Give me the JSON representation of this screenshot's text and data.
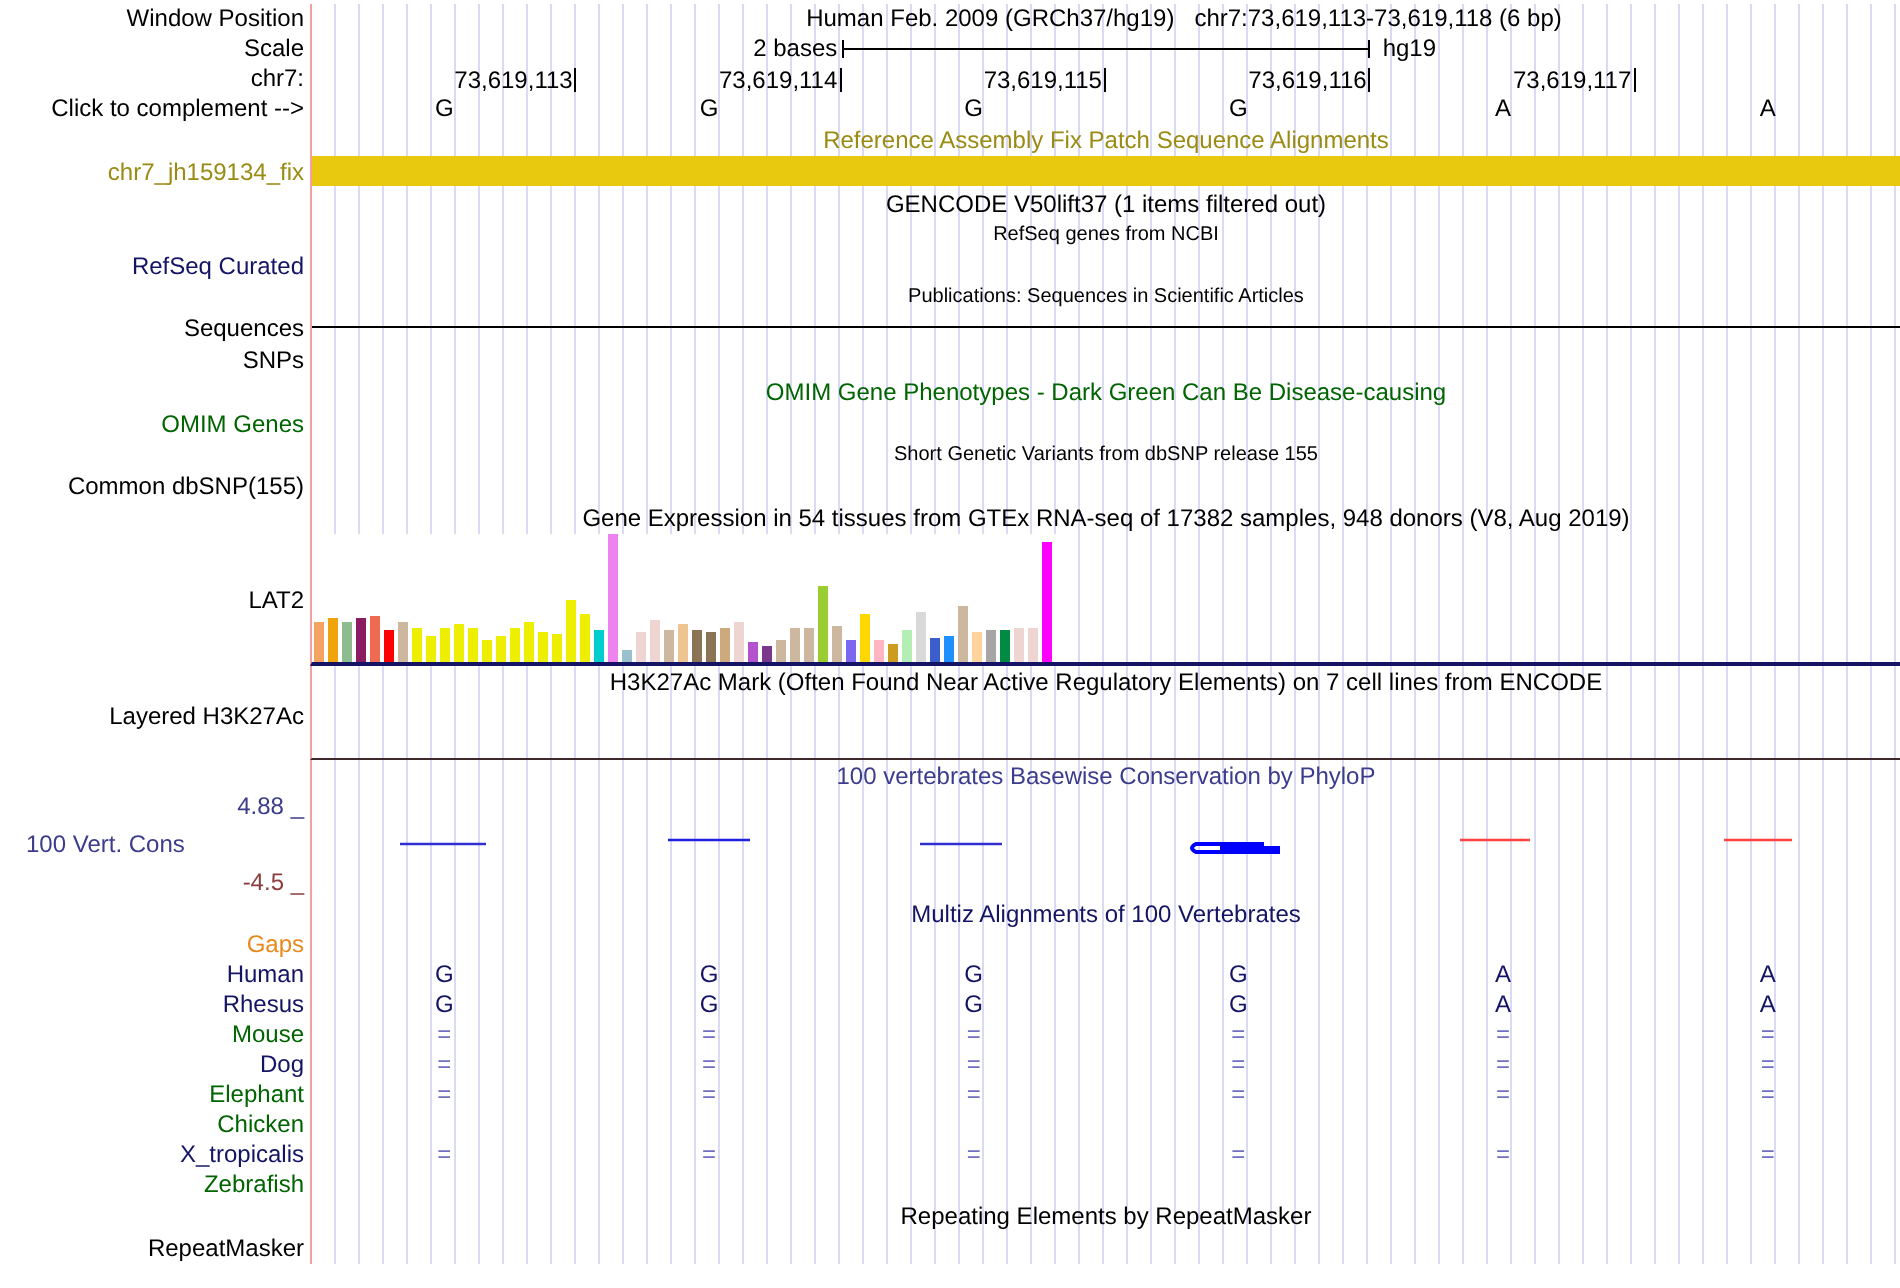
{
  "position": {
    "label": "Window Position",
    "assembly": "Human Feb. 2009 (GRCh37/hg19)",
    "range": "chr7:73,619,113-73,619,118 (6 bp)"
  },
  "scale": {
    "label": "Scale",
    "length": "2 bases",
    "assembly": "hg19"
  },
  "ruler": {
    "label": "chr7:",
    "ticks": [
      "73,619,113",
      "73,619,114",
      "73,619,115",
      "73,619,116",
      "73,619,117"
    ]
  },
  "complement": {
    "label": "Click to complement -->",
    "bases": [
      "G",
      "G",
      "G",
      "G",
      "A",
      "A"
    ]
  },
  "rows": [
    {
      "kind": "title",
      "text": "Reference Assembly Fix Patch Sequence Alignments",
      "color": "#9a8b13"
    },
    {
      "kind": "bar",
      "label": "chr7_jh159134_fix",
      "color": "#9a8b13"
    },
    {
      "kind": "title",
      "text": "GENCODE V50lift37 (1 items filtered out)",
      "color": "#000000"
    },
    {
      "kind": "subtitle",
      "text": "RefSeq genes from NCBI"
    },
    {
      "kind": "label",
      "label": "RefSeq Curated",
      "color": "#141464"
    },
    {
      "kind": "subtitle",
      "text": "Publications: Sequences in Scientific Articles"
    },
    {
      "kind": "line",
      "label": "Sequences",
      "color": "#000000"
    },
    {
      "kind": "label",
      "label": "SNPs",
      "color": "#000000"
    },
    {
      "kind": "title",
      "text": "OMIM Gene Phenotypes - Dark Green Can Be Disease-causing",
      "color": "#006400"
    },
    {
      "kind": "label",
      "label": "OMIM Genes",
      "color": "#006400"
    },
    {
      "kind": "subtitle",
      "text": "Short Genetic Variants from dbSNP release 155"
    },
    {
      "kind": "label",
      "label": "Common dbSNP(155)",
      "color": "#000000"
    },
    {
      "kind": "title",
      "text": "Gene Expression in 54 tissues from GTEx RNA-seq of 17382 samples, 948 donors (V8, Aug 2019)",
      "color": "#000000"
    },
    {
      "kind": "expression",
      "label": "LAT2",
      "color": "#000000"
    },
    {
      "kind": "title",
      "text": "H3K27Ac Mark (Often Found Near Active Regulatory Elements) on 7 cell lines from ENCODE",
      "color": "#000000"
    },
    {
      "kind": "layered",
      "label": "Layered H3K27Ac",
      "color": "#000000"
    },
    {
      "kind": "title",
      "text": "100 vertebrates Basewise Conservation by PhyloP",
      "color": "#3c3c8c"
    },
    {
      "kind": "conservation",
      "label": "100 Vert. Cons",
      "scale_max": "4.88 _",
      "scale_min": "-4.5 _",
      "color": "#3c3c8c"
    },
    {
      "kind": "title",
      "text": "Multiz Alignments of 100 Vertebrates",
      "color": "#141464"
    },
    {
      "kind": "species",
      "label": "Gaps",
      "color": "#e8891c"
    },
    {
      "kind": "species",
      "label": "Human",
      "color": "#141464",
      "matches": false,
      "bases": [
        "G",
        "G",
        "G",
        "G",
        "A",
        "A"
      ]
    },
    {
      "kind": "species",
      "label": "Rhesus",
      "color": "#141464",
      "matches": false,
      "bases": [
        "G",
        "G",
        "G",
        "G",
        "A",
        "A"
      ]
    },
    {
      "kind": "species",
      "label": "Mouse",
      "color": "#006400",
      "matches": true,
      "bases": [
        "=",
        "=",
        "=",
        "=",
        "=",
        "="
      ]
    },
    {
      "kind": "species",
      "label": "Dog",
      "color": "#141464",
      "matches": true,
      "bases": [
        "=",
        "=",
        "=",
        "=",
        "=",
        "="
      ]
    },
    {
      "kind": "species",
      "label": "Elephant",
      "color": "#006400",
      "matches": true,
      "bases": [
        "=",
        "=",
        "=",
        "=",
        "=",
        "="
      ]
    },
    {
      "kind": "species",
      "label": "Chicken",
      "color": "#006400"
    },
    {
      "kind": "species",
      "label": "X_tropicalis",
      "color": "#141464",
      "matches": true,
      "bases": [
        "=",
        "=",
        "=",
        "=",
        "=",
        "="
      ]
    },
    {
      "kind": "species",
      "label": "Zebrafish",
      "color": "#006400"
    },
    {
      "kind": "title",
      "text": "Repeating Elements by RepeatMasker",
      "color": "#000000"
    },
    {
      "kind": "label",
      "label": "RepeatMasker",
      "color": "#000000"
    }
  ]
}
